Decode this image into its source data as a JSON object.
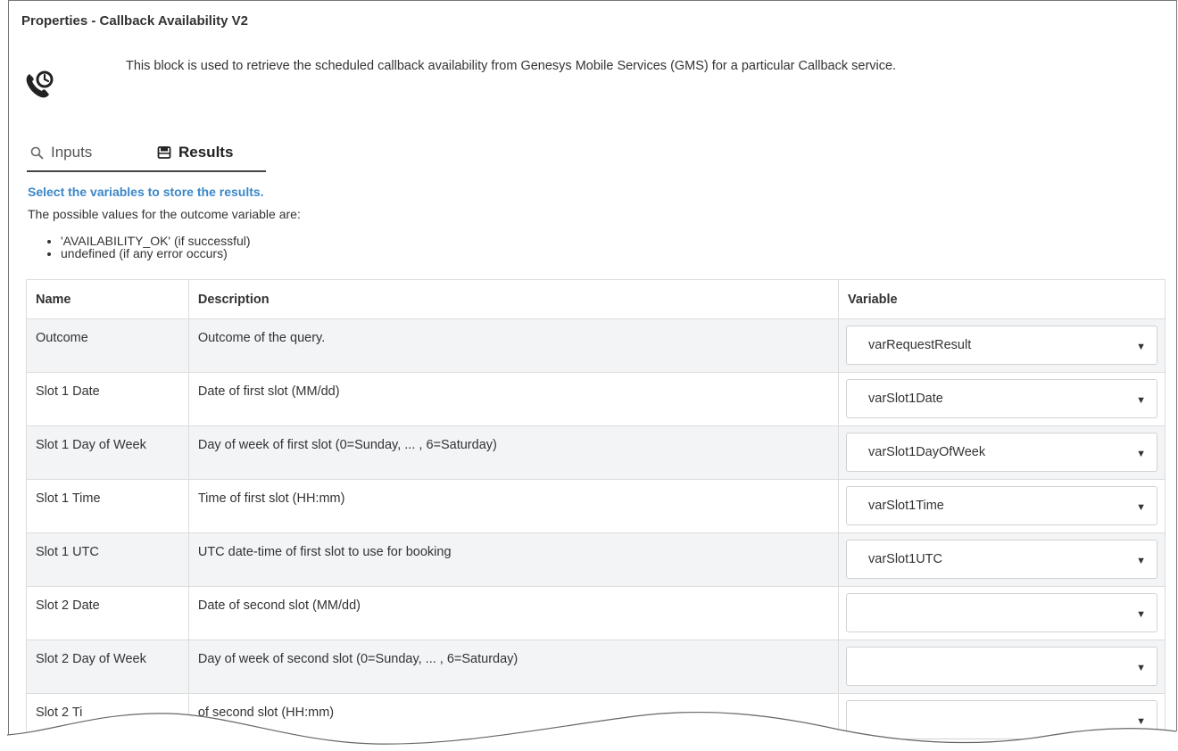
{
  "panel": {
    "title": "Properties - Callback Availability V2",
    "description": "This block is used to retrieve the scheduled callback availability from Genesys Mobile Services (GMS) for a particular Callback service."
  },
  "tabs": [
    {
      "label": "Inputs",
      "icon": "search-icon",
      "active": false
    },
    {
      "label": "Results",
      "icon": "save-icon",
      "active": true
    }
  ],
  "results": {
    "heading": "Select the variables to store the results.",
    "intro": "The possible values for the outcome variable are:",
    "values": [
      "'AVAILABILITY_OK' (if successful)",
      "undefined (if any error occurs)"
    ]
  },
  "table": {
    "headers": {
      "name": "Name",
      "description": "Description",
      "variable": "Variable"
    },
    "rows": [
      {
        "name": "Outcome",
        "description": "Outcome of the query.",
        "variable": "varRequestResult"
      },
      {
        "name": "Slot 1 Date",
        "description": "Date of first slot (MM/dd)",
        "variable": "varSlot1Date"
      },
      {
        "name": "Slot 1 Day of Week",
        "description": "Day of week of first slot (0=Sunday, ... , 6=Saturday)",
        "variable": "varSlot1DayOfWeek"
      },
      {
        "name": "Slot 1 Time",
        "description": "Time of first slot (HH:mm)",
        "variable": "varSlot1Time"
      },
      {
        "name": "Slot 1 UTC",
        "description": "UTC date-time of first slot to use for booking",
        "variable": "varSlot1UTC"
      },
      {
        "name": "Slot 2 Date",
        "description": "Date of second slot (MM/dd)",
        "variable": ""
      },
      {
        "name": "Slot 2 Day of Week",
        "description": "Day of week of second slot (0=Sunday, ... , 6=Saturday)",
        "variable": ""
      },
      {
        "name": "Slot 2 Ti",
        "description": "of second slot (HH:mm)",
        "variable": ""
      }
    ]
  },
  "colors": {
    "link_blue": "#3a87c8",
    "row_alt": "#f3f4f6",
    "border": "#dcdcdc"
  }
}
